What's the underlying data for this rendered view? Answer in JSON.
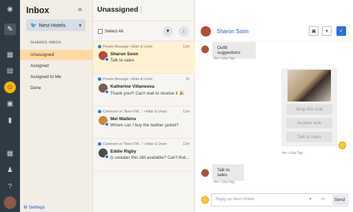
{
  "nav": {
    "title": "Inbox",
    "collapse_icon": "double-chevron-left",
    "group": "Nest Hotels",
    "section": "SHARED INBOX",
    "items": [
      "Unassigned",
      "Assigned",
      "Assigned to Me",
      "Done"
    ],
    "settings": "Settings"
  },
  "list": {
    "title": "Unassigned",
    "select_all": "Select All",
    "conversations": [
      {
        "meta": "Private Message • Alder & Union",
        "time": "12m",
        "name": "Sharon Soon",
        "msg": "Talk to sales",
        "color": "#b24d3a"
      },
      {
        "meta": "Private Message • Alder & Union",
        "time": "1h",
        "name": "Katherine Villaneuva",
        "msg": "Thank you!!! Can't wait to receive it 🎉",
        "color": "#7a5c4e"
      },
      {
        "meta": "Comment on \"New F/W...\" • Alder & Union",
        "time": "12m",
        "name": "Mel Watkins",
        "msg": "Where can I buy the leather jacket?",
        "color": "#c98a3a"
      },
      {
        "meta": "Comment on \"New F/W...\" • Alder & Union",
        "time": "12m",
        "name": "Eddie Rigby",
        "msg": "Is sweater this still available? Can't find...",
        "color": "#4c4c4c"
      }
    ]
  },
  "chat": {
    "contact": "Sharon Soon",
    "msg1": "Outfit suggestions",
    "msg1_meta": "4m • Like  Tag",
    "options": [
      "Shop this look",
      "Another look",
      "Talk to sales"
    ],
    "card_meta": "4m • Like  Tag",
    "msg2": "Talk to sales",
    "msg2_meta": "4m • Like  Tag",
    "reply_placeholder": "Reply as Nest Hotels",
    "send": "Send"
  }
}
